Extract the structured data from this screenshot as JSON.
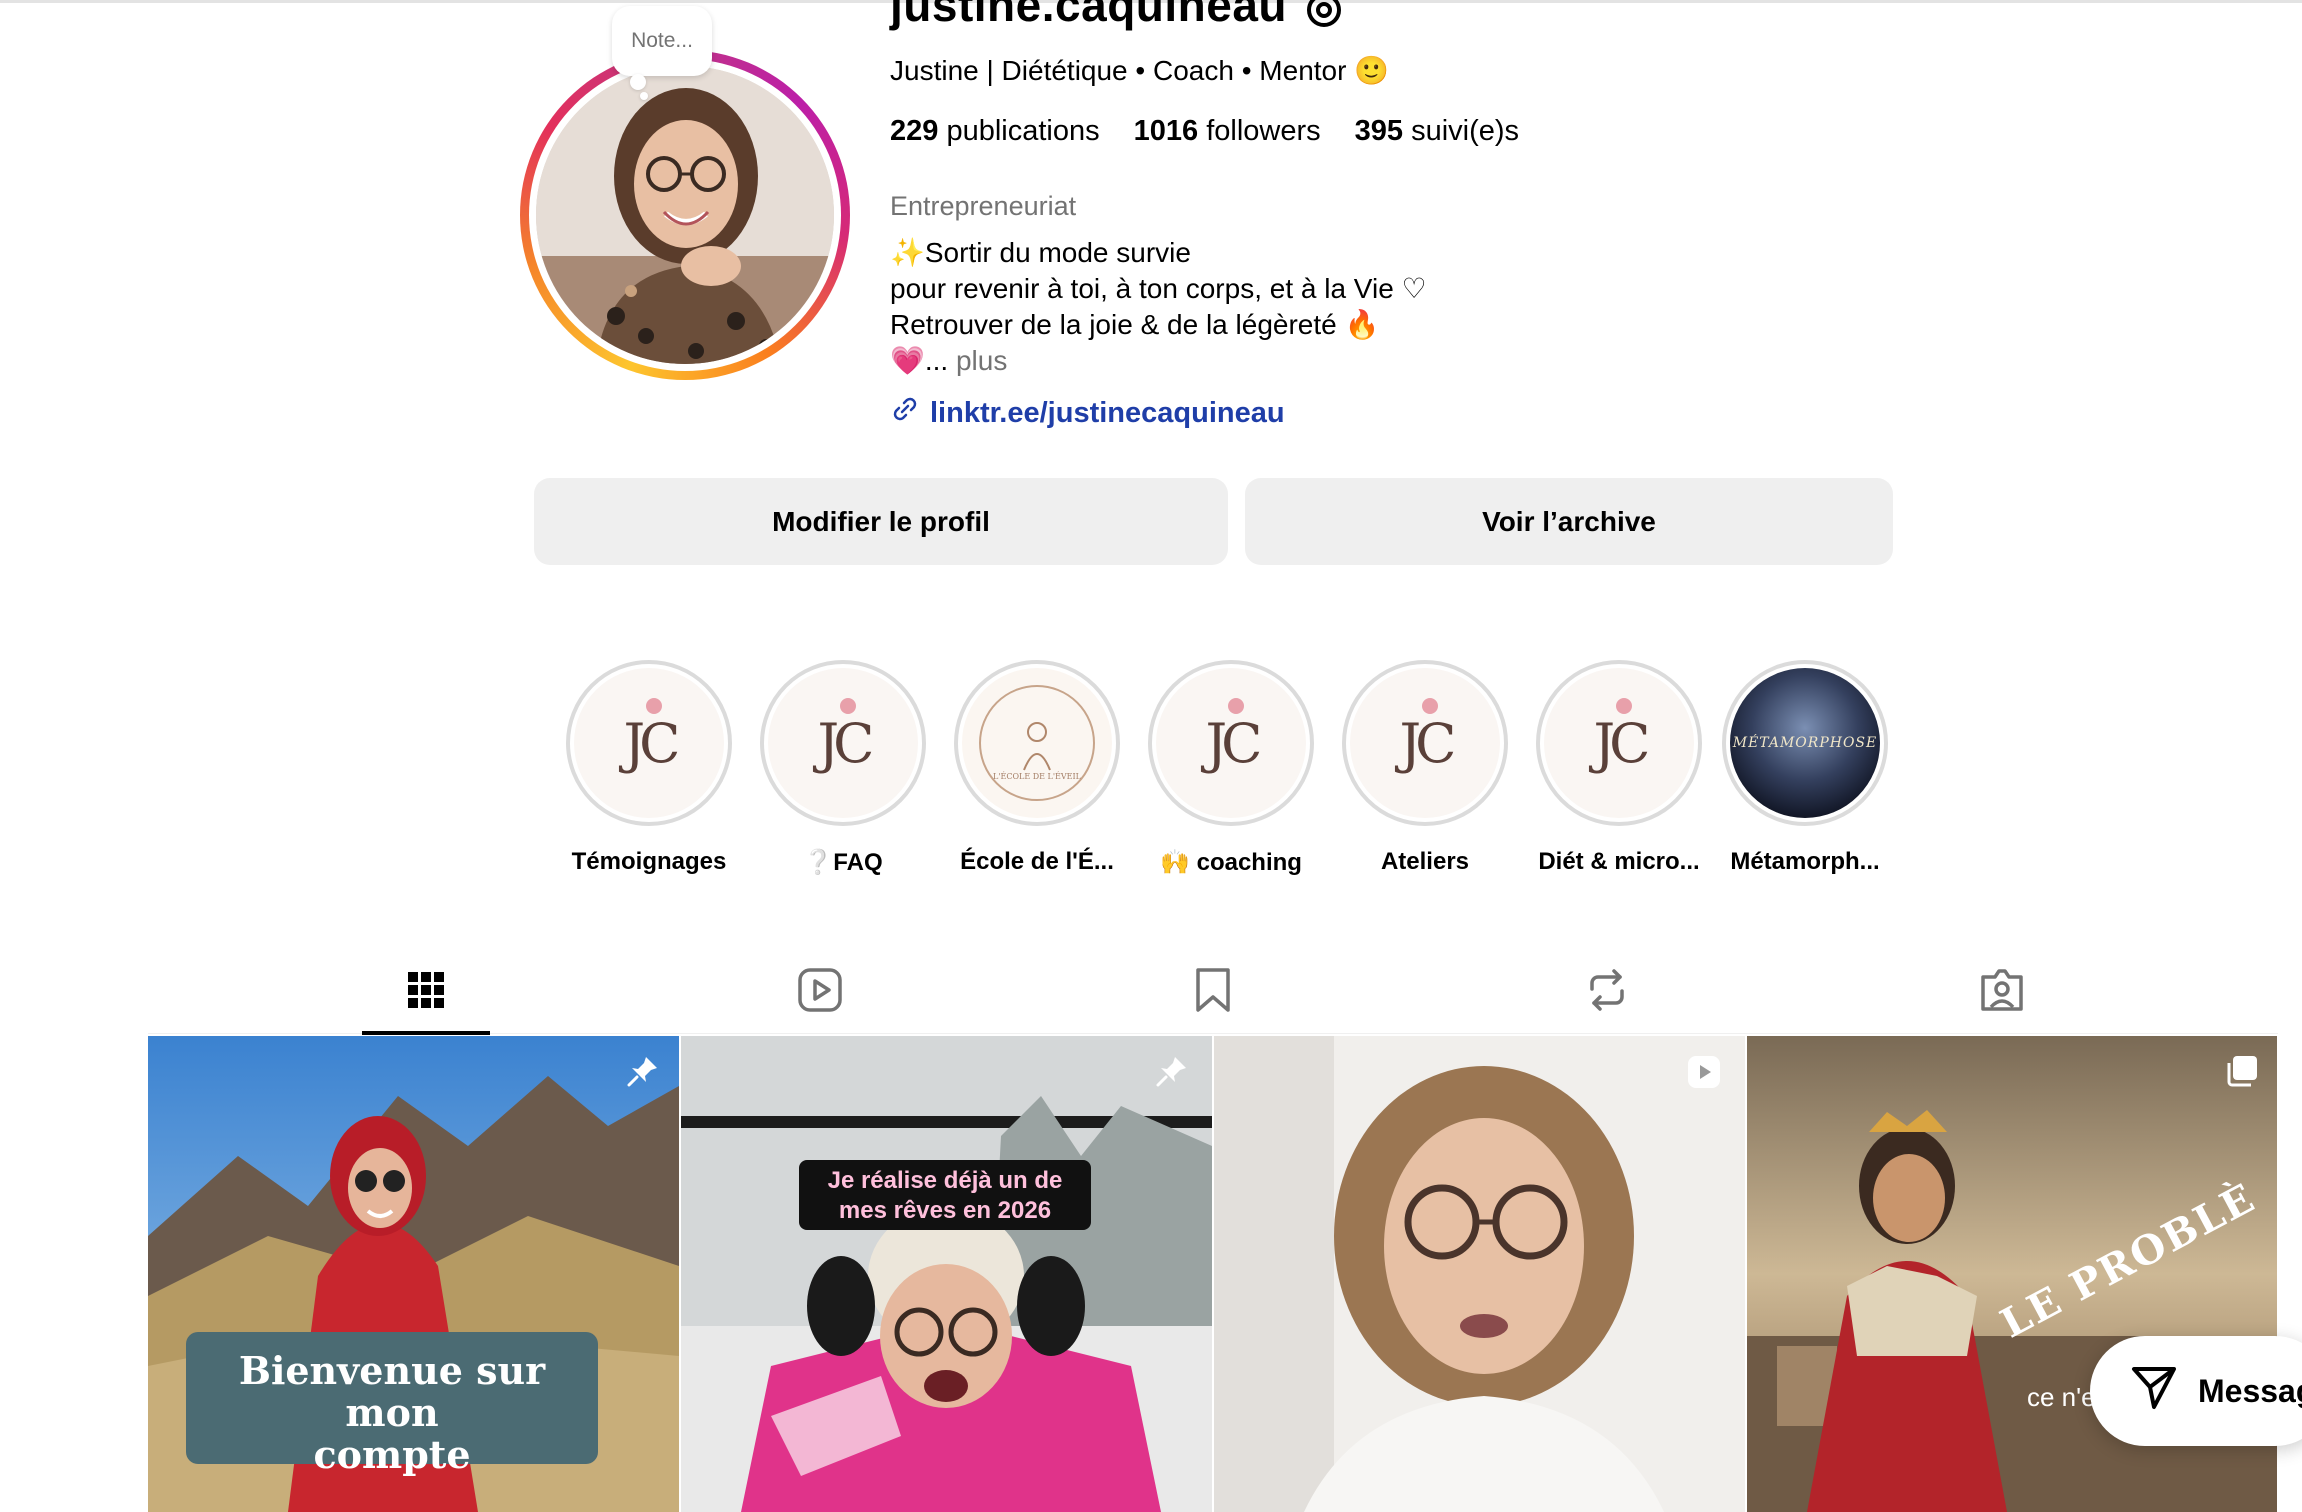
{
  "profile": {
    "username": "justine.caquineau",
    "note": "Note...",
    "full_name": "Justine | Diététique • Coach • Mentor 🙂",
    "stats": {
      "posts_count": "229",
      "posts_label": "publications",
      "followers_count": "1016",
      "followers_label": "followers",
      "following_count": "395",
      "following_label": "suivi(e)s"
    },
    "category": "Entrepreneuriat",
    "bio": {
      "line1": "✨Sortir du mode survie",
      "line2": "pour revenir à toi, à ton corps, et à la Vie ♡",
      "line3": "Retrouver de la joie & de la légèreté 🔥",
      "line4": "💗...",
      "more": " plus"
    },
    "link": "linktr.ee/justinecaquineau"
  },
  "actions": {
    "edit_profile": "Modifier le profil",
    "view_archive": "Voir l’archive"
  },
  "highlights": [
    {
      "label": "Témoignages",
      "icon": "jc-logo"
    },
    {
      "label": "❔FAQ",
      "icon": "jc-logo"
    },
    {
      "label": "École de l'É...",
      "icon": "ecole-logo",
      "inner_text": "L'ÉCOLE DE L'ÉVEIL"
    },
    {
      "label": "🙌 coaching",
      "icon": "jc-logo"
    },
    {
      "label": "Ateliers",
      "icon": "jc-logo"
    },
    {
      "label": "Diét & micro...",
      "icon": "jc-logo"
    },
    {
      "label": "Métamorph...",
      "icon": "metamorphose-image",
      "inner_text": "MÉTAMORPHOSE"
    }
  ],
  "tabs": [
    {
      "name": "posts",
      "icon": "grid-icon",
      "active": true
    },
    {
      "name": "reels",
      "icon": "reels-icon",
      "active": false
    },
    {
      "name": "saved",
      "icon": "bookmark-icon",
      "active": false
    },
    {
      "name": "reposts",
      "icon": "repost-icon",
      "active": false
    },
    {
      "name": "tagged",
      "icon": "tagged-icon",
      "active": false
    }
  ],
  "posts": [
    {
      "overlay_text_1": "Bienvenue sur mon",
      "overlay_text_2": "compte",
      "badge": "pin-icon"
    },
    {
      "overlay_text_1": "Je réalise déjà un de",
      "overlay_text_2": "mes rêves en 2026",
      "badge": "pin-icon"
    },
    {
      "overlay_text_1": "",
      "overlay_text_2": "",
      "badge": "reel-icon"
    },
    {
      "overlay_text_1": "LE PROBLÈ",
      "overlay_text_2": "ce n'e",
      "badge": "carousel-icon"
    }
  ],
  "message_button": "Messag",
  "colors": {
    "link": "#1f3ea8",
    "button_bg": "#efefef",
    "muted_text": "#737373",
    "welcome_box": "#4b6b73",
    "dream_label_bg": "#111111",
    "dream_label_text": "#ffc0dc"
  }
}
